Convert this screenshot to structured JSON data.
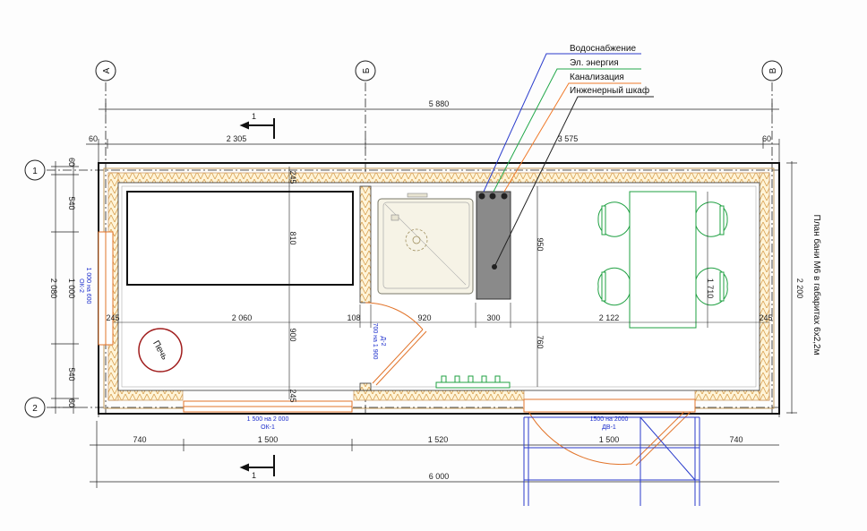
{
  "legend": {
    "items": [
      {
        "label": "Водоснабжение",
        "color": "#2a3ccc"
      },
      {
        "label": "Эл. энергия",
        "color": "#22a84a"
      },
      {
        "label": "Канализация",
        "color": "#f07a2a"
      },
      {
        "label": "Инженерный шкаф",
        "color": "#222222"
      }
    ]
  },
  "axes": {
    "vertical": [
      "А",
      "Б",
      "В"
    ],
    "horizontal": [
      "1",
      "2"
    ]
  },
  "section_mark": "1",
  "title": "План бани М6 в габаритах 6х2,2м",
  "stove_label": "Печь",
  "dimensions": {
    "top_total": "5 880",
    "top_left_offset": "60",
    "top_a": "2 305",
    "top_b": "3 575",
    "top_right_offset": "60",
    "left_60_top": "60",
    "left_540_top": "540",
    "left_1000": "1 000",
    "left_540_bottom": "540",
    "left_60_bottom": "60",
    "left_total": "2 080",
    "right_total": "2 200",
    "inner_245_top": "245",
    "inner_810": "810",
    "inner_900": "900",
    "inner_245_bottom": "245",
    "inner_950": "950",
    "inner_760": "760",
    "inner_1710": "1 710",
    "row_245_left": "245",
    "row_2060": "2 060",
    "row_108": "108",
    "row_920": "920",
    "row_300": "300",
    "row_2122": "2 122",
    "row_245_right": "245",
    "bottom_740_left": "740",
    "bottom_1500_a": "1 500",
    "bottom_1520": "1 520",
    "bottom_1500_b": "1 500",
    "bottom_740_right": "740",
    "bottom_total": "6 000"
  },
  "openings": {
    "window_left_size": "1 000 на 600",
    "window_left_code": "ОК-2",
    "window_bottom_size": "1 500 на 2 000",
    "window_bottom_code": "ОК-1",
    "door_inner_size": "700 на 1 900",
    "door_inner_code": "Д-2",
    "door_outer_size": "1500 на 2000",
    "door_outer_code": "ДВ-1"
  }
}
